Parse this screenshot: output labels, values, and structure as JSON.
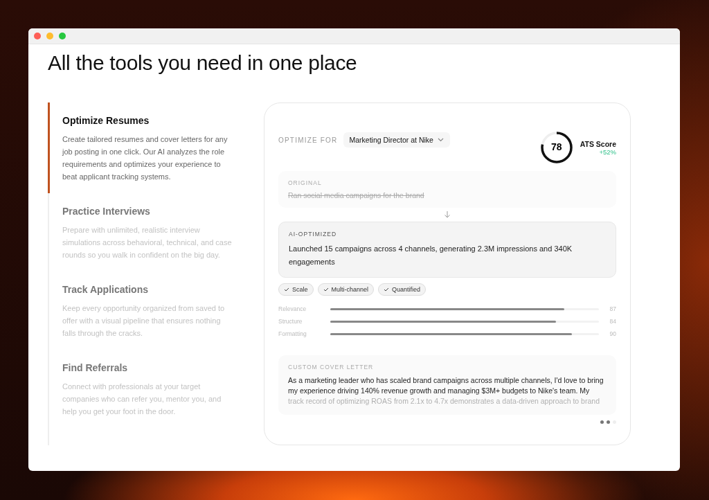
{
  "heading": "All the tools you need in one place",
  "features": [
    {
      "title": "Optimize Resumes",
      "description": "Create tailored resumes and cover letters for any job posting in one click. Our AI analyzes the role requirements and optimizes your experience to beat applicant tracking systems.",
      "selected": true
    },
    {
      "title": "Practice Interviews",
      "description": "Prepare with unlimited, realistic interview simulations across behavioral, technical, and case rounds so you walk in confident on the big day.",
      "selected": false
    },
    {
      "title": "Track Applications",
      "description": "Keep every opportunity organized from saved to offer with a visual pipeline that ensures nothing falls through the cracks.",
      "selected": false
    },
    {
      "title": "Find Referrals",
      "description": "Connect with professionals at your target companies who can refer you, mentor you, and help you get your foot in the door.",
      "selected": false
    }
  ],
  "demo": {
    "optimize_label": "OPTIMIZE FOR",
    "target": "Marketing Director at Nike",
    "score": {
      "value": "78",
      "level": 0.78,
      "label": "ATS Score",
      "change": "+52%"
    },
    "original": {
      "label": "ORIGINAL",
      "text": "Ran social media campaigns for the brand"
    },
    "optimized": {
      "label": "AI-OPTIMIZED",
      "text": "Launched 15 campaigns across 4 channels, generating 2.3M impressions and 340K engagements"
    },
    "tags": [
      "Scale",
      "Multi-channel",
      "Quantified"
    ],
    "metrics": [
      {
        "name": "Relevance",
        "level": 0.87,
        "reading": "87"
      },
      {
        "name": "Structure",
        "level": 0.84,
        "reading": "84"
      },
      {
        "name": "Formatting",
        "level": 0.9,
        "reading": "90"
      }
    ],
    "cover_letter": {
      "label": "CUSTOM COVER LETTER",
      "text": "As a marketing leader who has scaled brand campaigns across multiple channels, I'd love to bring my experience driving 140% revenue growth and managing $3M+ budgets to Nike's team. My track record of optimizing ROAS from 2.1x to 4.7x demonstrates a data-driven approach to brand"
    },
    "dots": [
      {
        "selected": true
      },
      {
        "selected": true
      },
      {
        "selected": false
      }
    ]
  }
}
